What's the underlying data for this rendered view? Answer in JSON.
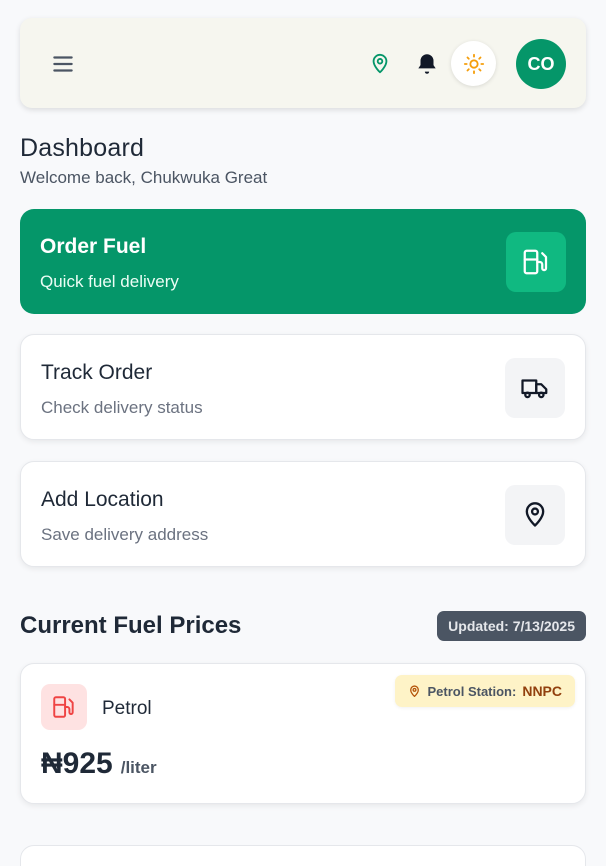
{
  "header": {
    "avatar_initials": "CO",
    "icons": [
      "menu-icon",
      "location-pin-icon",
      "bell-icon",
      "sun-icon"
    ]
  },
  "dashboard": {
    "title": "Dashboard",
    "welcome": "Welcome back, Chukwuka Great"
  },
  "actions": [
    {
      "title": "Order Fuel",
      "subtitle": "Quick fuel delivery",
      "icon": "fuel-pump-icon"
    },
    {
      "title": "Track Order",
      "subtitle": "Check delivery status",
      "icon": "truck-icon"
    },
    {
      "title": "Add Location",
      "subtitle": "Save delivery address",
      "icon": "location-pin-icon"
    }
  ],
  "prices": {
    "section_title": "Current Fuel Prices",
    "updated": "Updated: 7/13/2025",
    "items": [
      {
        "name": "Petrol",
        "station_label": "Petrol Station:",
        "station_value": "NNPC",
        "price": "₦925",
        "unit": "/liter",
        "icon": "fuel-pump-icon"
      }
    ]
  },
  "colors": {
    "brand_green": "#059669",
    "icon_green": "#10b981",
    "background": "#f8f9fb",
    "badge_dark": "#4b5563",
    "station_badge_bg": "#fef3c7",
    "petrol_red": "#ef4444"
  }
}
